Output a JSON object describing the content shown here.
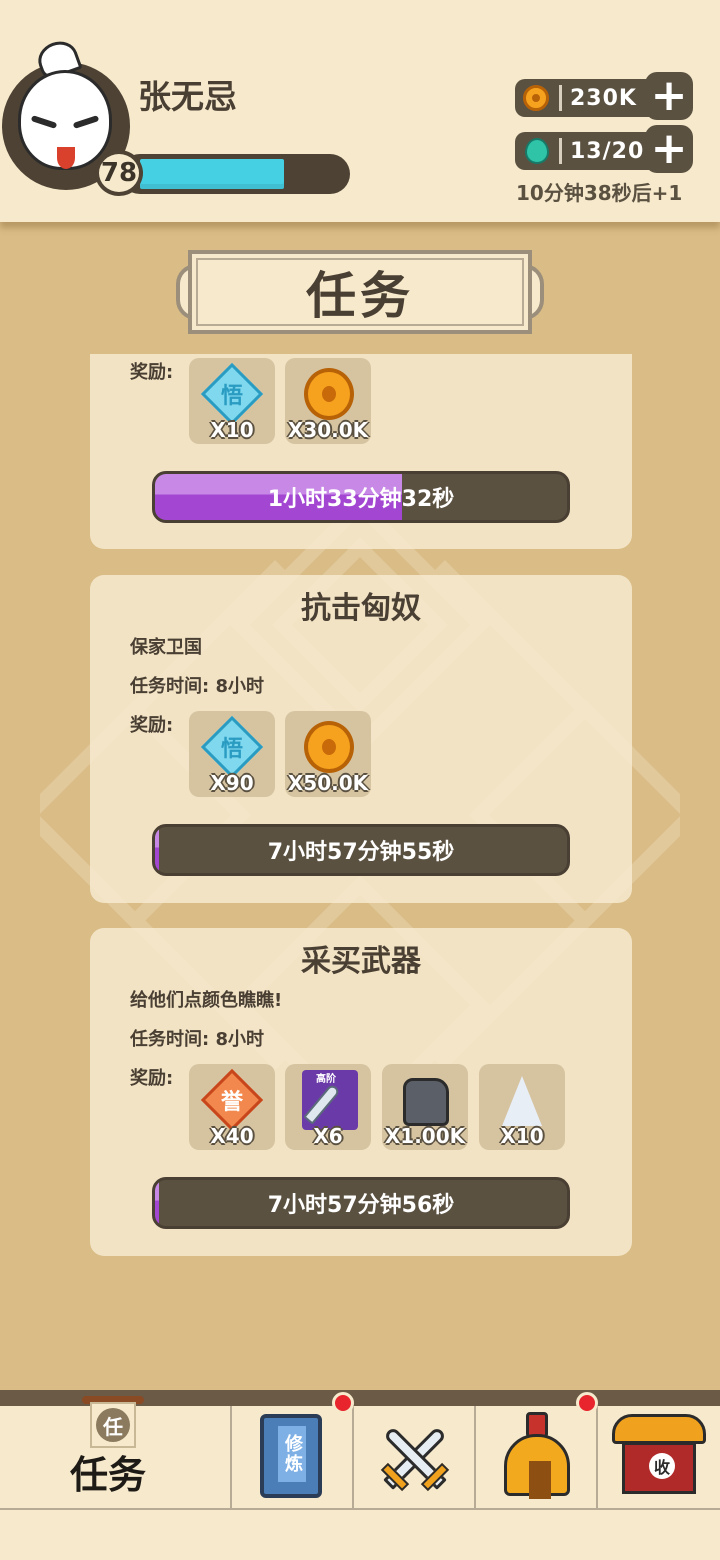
{
  "player": {
    "name": "张无忌",
    "level": "78",
    "xp_fraction": 0.72
  },
  "resources": {
    "gold": {
      "icon": "coin-icon",
      "value": "230K",
      "plus_icon": "plus-icon"
    },
    "stamina": {
      "icon": "gourd-icon",
      "value": "13/20",
      "plus_icon": "plus-icon"
    },
    "regen_text": "10分钟38秒后+1"
  },
  "page": {
    "title": "任务"
  },
  "tasks": [
    {
      "title": "",
      "reward_label": "奖励:",
      "rewards": [
        {
          "icon": "wisdom-token-icon",
          "glyph": "悟",
          "qty": "X10"
        },
        {
          "icon": "coin-icon",
          "qty": "X30.0K"
        }
      ],
      "timer": "1小时33分钟32秒",
      "progress": 0.6
    },
    {
      "title": "抗击匈奴",
      "description": "保家卫国",
      "time_label": "任务时间: 8小时",
      "reward_label": "奖励:",
      "rewards": [
        {
          "icon": "wisdom-token-icon",
          "glyph": "悟",
          "qty": "X90"
        },
        {
          "icon": "coin-icon",
          "qty": "X50.0K"
        }
      ],
      "timer": "7小时57分钟55秒",
      "progress": 0.01
    },
    {
      "title": "采买武器",
      "description": "给他们点颜色瞧瞧!",
      "time_label": "任务时间: 8小时",
      "reward_label": "奖励:",
      "rewards": [
        {
          "icon": "honor-token-icon",
          "glyph": "誉",
          "qty": "X40"
        },
        {
          "icon": "sword-icon",
          "tag": "高阶",
          "qty": "X6"
        },
        {
          "icon": "ore-icon",
          "qty": "X1.00K"
        },
        {
          "icon": "crystal-icon",
          "qty": "X10"
        }
      ],
      "timer": "7小时57分钟56秒",
      "progress": 0.01
    }
  ],
  "nav": {
    "items": [
      {
        "label": "任务",
        "glyph": "任",
        "icon": "scroll-icon",
        "active": true,
        "badge": false
      },
      {
        "icon": "book-icon",
        "glyph": "修炼",
        "badge": true
      },
      {
        "icon": "crossed-swords-icon",
        "badge": false
      },
      {
        "icon": "helmet-icon",
        "badge": true
      },
      {
        "icon": "house-icon",
        "glyph": "收",
        "badge": false
      }
    ]
  },
  "colors": {
    "background": "#d9bc86",
    "panel": "#f6e9cc",
    "dark": "#5b5141",
    "xp": "#45d0e3",
    "progress": "#a347d2",
    "badge": "#e8242c"
  }
}
